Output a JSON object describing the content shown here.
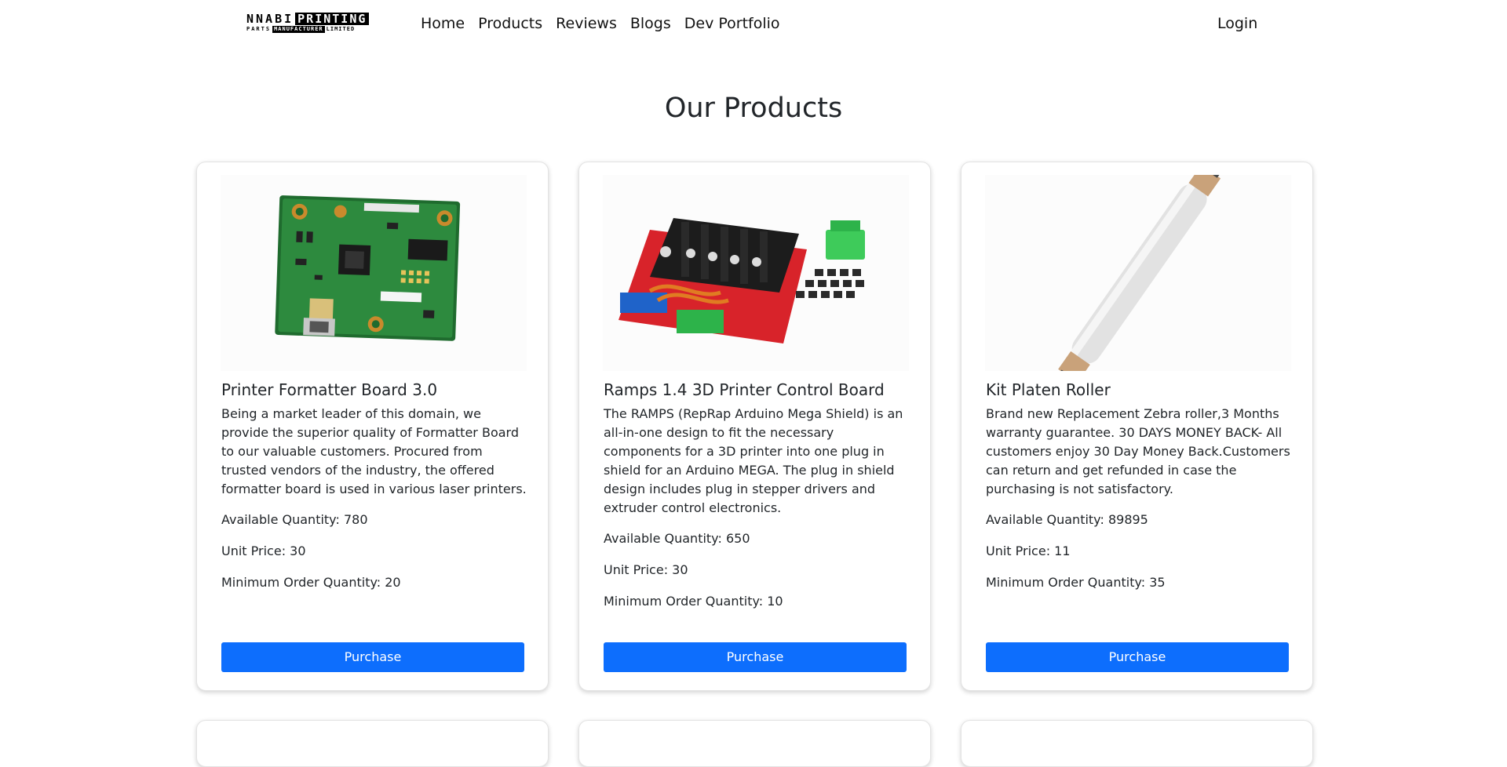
{
  "nav": {
    "logo": {
      "word1": "NNABI",
      "word2": "PRINTING",
      "parts": "PARTS",
      "manufacturer": "MANUFACTURER",
      "limited": "LIMITED"
    },
    "links": [
      "Home",
      "Products",
      "Reviews",
      "Blogs",
      "Dev Portfolio"
    ],
    "login": "Login"
  },
  "page_title": "Our Products",
  "accent_color": "#0d6efd",
  "products": [
    {
      "title": "Printer Formatter Board 3.0",
      "description": "Being a market leader of this domain, we provide the superior quality of Formatter Board to our valuable customers. Procured from trusted vendors of the industry, the offered formatter board is used in various laser printers.",
      "available": "Available Quantity: 780",
      "price": "Unit Price: 30",
      "min_order": "Minimum Order Quantity: 20",
      "button": "Purchase"
    },
    {
      "title": "Ramps 1.4 3D Printer Control Board",
      "description": "The RAMPS (RepRap Arduino Mega Shield) is an all-in-one design to fit the necessary components for a 3D printer into one plug in shield for an Arduino MEGA. The plug in shield design includes plug in stepper drivers and extruder control electronics.",
      "available": "Available Quantity: 650",
      "price": "Unit Price: 30",
      "min_order": "Minimum Order Quantity: 10",
      "button": "Purchase"
    },
    {
      "title": "Kit Platen Roller",
      "description": "Brand new Replacement Zebra roller,3 Months warranty guarantee. 30 DAYS MONEY BACK- All customers enjoy 30 Day Money Back.Customers can return and get refunded in case the purchasing is not satisfactory.",
      "available": "Available Quantity: 89895",
      "price": "Unit Price: 11",
      "min_order": "Minimum Order Quantity: 35",
      "button": "Purchase"
    }
  ]
}
